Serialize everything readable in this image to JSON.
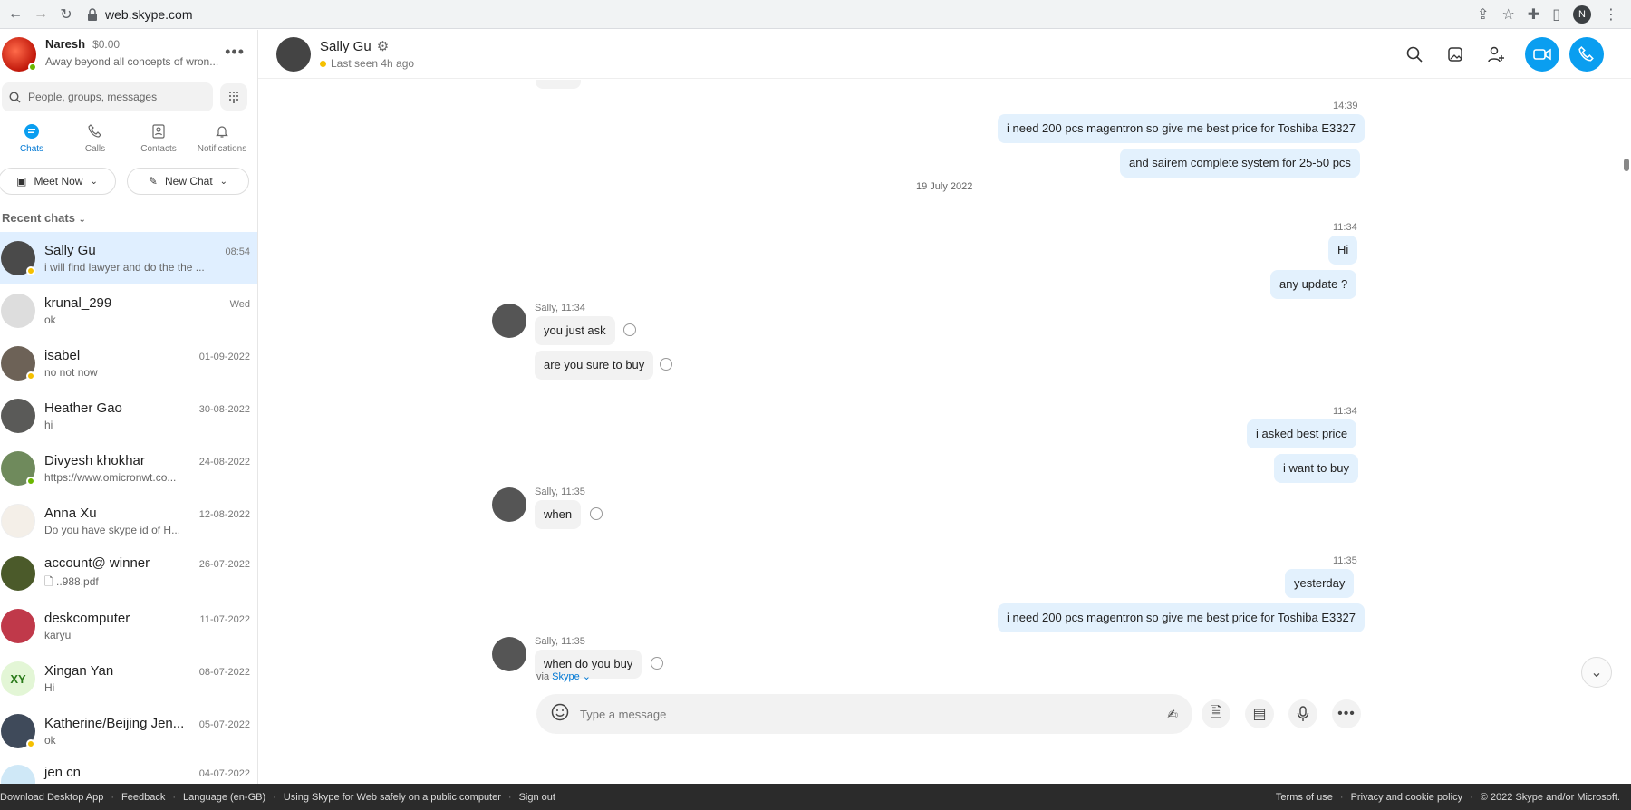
{
  "browser": {
    "url": "web.skype.com",
    "profile_initial": "N"
  },
  "profile": {
    "name": "Naresh",
    "balance": "$0.00",
    "mood": "Away beyond all concepts of wron..."
  },
  "search": {
    "placeholder": "People, groups, messages"
  },
  "tabs": [
    {
      "label": "Chats"
    },
    {
      "label": "Calls"
    },
    {
      "label": "Contacts"
    },
    {
      "label": "Notifications"
    }
  ],
  "actions": {
    "meet_now": "Meet Now",
    "new_chat": "New Chat"
  },
  "recent_label": "Recent chats",
  "chats": [
    {
      "name": "Sally Gu",
      "time": "08:54",
      "preview": "i will find lawyer and do the the ..."
    },
    {
      "name": "krunal_299",
      "time": "Wed",
      "preview": "ok"
    },
    {
      "name": "isabel",
      "time": "01-09-2022",
      "preview": "no not now"
    },
    {
      "name": "Heather Gao",
      "time": "30-08-2022",
      "preview": "hi"
    },
    {
      "name": "Divyesh khokhar",
      "time": "24-08-2022",
      "preview": "https://www.omicronwt.co..."
    },
    {
      "name": "Anna Xu",
      "time": "12-08-2022",
      "preview": "Do you have skype id of H..."
    },
    {
      "name": "account@ winner",
      "time": "26-07-2022",
      "preview": "..988.pdf"
    },
    {
      "name": "deskcomputer",
      "time": "11-07-2022",
      "preview": "karyu"
    },
    {
      "name": "Xingan  Yan",
      "time": "08-07-2022",
      "preview": "Hi",
      "initials": "XY"
    },
    {
      "name": "Katherine/Beijing Jen...",
      "time": "05-07-2022",
      "preview": "ok"
    },
    {
      "name": "jen cn",
      "time": "04-07-2022",
      "preview": ""
    }
  ],
  "header": {
    "name": "Sally Gu",
    "status": "Last seen 4h ago"
  },
  "messages": {
    "t1": "14:39",
    "m1": "i need 200 pcs magentron so give me best price for Toshiba E3327",
    "m2": "and sairem complete system for 25-50 pcs",
    "date": "19 July 2022",
    "t2": "11:34",
    "m3": "Hi",
    "m4": "any update ?",
    "s1": "Sally, 11:34",
    "m5": "you just ask",
    "m6": "are you sure to buy",
    "t3": "11:34",
    "m7": "i asked best price",
    "m8": "i want to buy",
    "s2": "Sally, 11:35",
    "m9": "when",
    "t4": "11:35",
    "m10": "yesterday",
    "m11": "i need 200 pcs magentron so give me best price for Toshiba E3327",
    "s3": "Sally, 11:35",
    "m12": "when do you buy"
  },
  "via": {
    "prefix": "via",
    "app": "Skype"
  },
  "composer": {
    "placeholder": "Type a message"
  },
  "footer": {
    "left": [
      "Download Desktop App",
      "Feedback",
      "Language (en-GB)",
      "Using Skype for Web safely on a public computer",
      "Sign out"
    ],
    "right": [
      "Terms of use",
      "Privacy and cookie policy",
      "© 2022 Skype and/or Microsoft."
    ]
  }
}
